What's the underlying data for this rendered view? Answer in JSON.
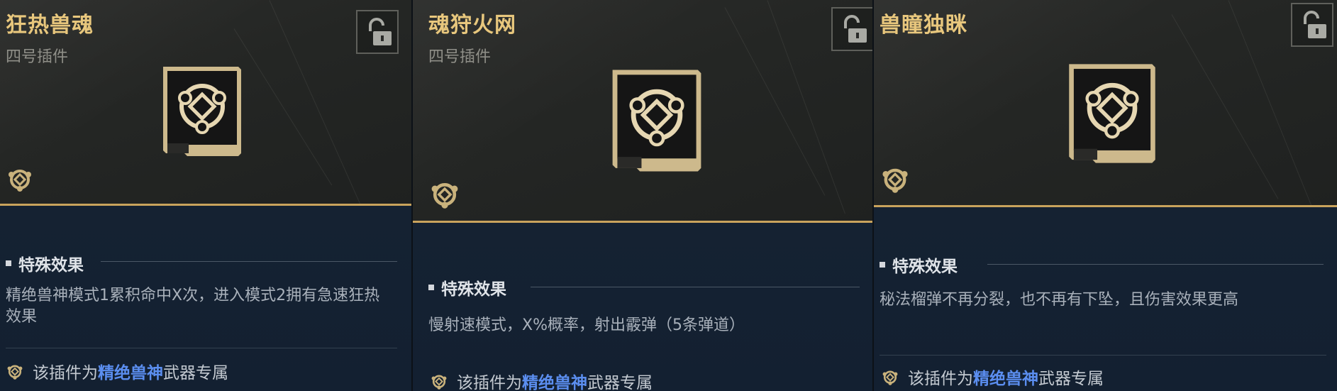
{
  "colors": {
    "gold": "#e8c77d",
    "accent_line": "#c9a35c",
    "highlight_blue": "#5b8ef0",
    "panel_top": "#262826",
    "panel_bottom": "#14202d"
  },
  "section_title": "特殊效果",
  "exclusive_prefix": "该插件为",
  "exclusive_weapon": "精绝兽神",
  "exclusive_suffix": "武器专属",
  "panels": [
    {
      "name": "狂热兽魂",
      "slot": "四号插件",
      "effect": "精绝兽神模式1累积命中X次，进入模式2拥有急速狂热效果",
      "lock_icon": "unlock-icon",
      "chip_icon": "triskelion-ring-icon"
    },
    {
      "name": "魂狩火网",
      "slot": "四号插件",
      "effect": "慢射速模式，X%概率，射出霰弹（5条弹道）",
      "lock_icon": "unlock-icon",
      "chip_icon": "triskelion-ring-icon"
    },
    {
      "name": "兽瞳独眯",
      "slot": "",
      "effect": "秘法榴弹不再分裂，也不再有下坠，且伤害效果更高",
      "lock_icon": "unlock-icon",
      "chip_icon": "triskelion-ring-icon"
    }
  ]
}
